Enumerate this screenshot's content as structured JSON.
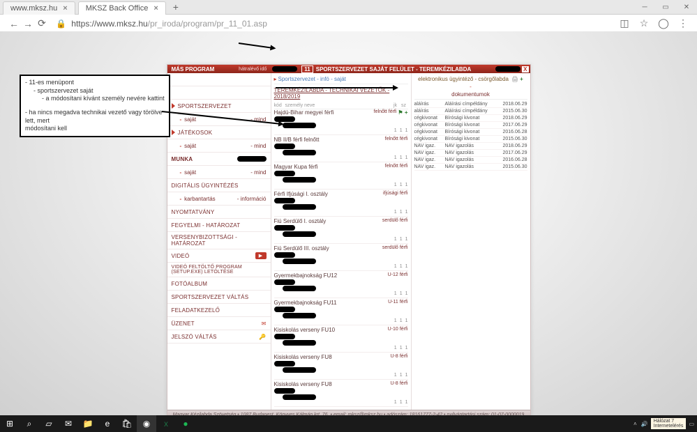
{
  "chrome": {
    "tab1": "www.mksz.hu",
    "tab2": "MKSZ Back Office",
    "url_host": "https://www.mksz.hu",
    "url_path": "/pr_iroda/program/pr_11_01.asp"
  },
  "header": {
    "left": "MÁS PROGRAM",
    "mid_small": "hátralévő idő",
    "badge": "11",
    "title": "SPORTSZERVEZET SAJÁT FELÜLET - TEREMKÉZILABDA"
  },
  "menu": {
    "items": [
      {
        "type": "red",
        "label": ""
      },
      {
        "type": "hdr",
        "label": ""
      },
      {
        "type": "tri",
        "label": "SPORTSZERVEZET"
      },
      {
        "type": "subpair",
        "left": "- saját",
        "right": "- mind"
      },
      {
        "type": "tri",
        "label": "JÁTÉKOSOK"
      },
      {
        "type": "subpair",
        "left": "- saját",
        "right": "- mind"
      },
      {
        "type": "redbold",
        "label": "MUNKA"
      },
      {
        "type": "subpair",
        "left": "- saját",
        "right": "- mind"
      },
      {
        "type": "red",
        "label": "DIGITÁLIS ÜGYINTÉZÉS"
      },
      {
        "type": "subpair",
        "left": "- karbantartás",
        "right": "- információ"
      },
      {
        "type": "red",
        "label": "NYOMTATVÁNY"
      },
      {
        "type": "red",
        "label": "FEGYELMI - HATÁROZAT"
      },
      {
        "type": "red",
        "label": "VERSENYBIZOTTSÁGI - HATÁROZAT"
      },
      {
        "type": "red",
        "label": "VIDEÓ",
        "icon": "vid"
      },
      {
        "type": "red",
        "label": "VIDEÓ feltöltő program (setup.exe) letöltése",
        "small": true
      },
      {
        "type": "red",
        "label": "FOTÓALBUM"
      },
      {
        "type": "red",
        "label": "SPORTSZERVEZET VÁLTÁS"
      },
      {
        "type": "red",
        "label": "FELADATKEZELŐ"
      },
      {
        "type": "red",
        "label": "ÜZENET",
        "icon": "mail"
      },
      {
        "type": "red",
        "label": "JELSZÓ VÁLTÁS",
        "icon": "key"
      }
    ]
  },
  "center": {
    "crumb": "Sportszervezet - infó - saját",
    "title": "TEREMKÉZILABDA - TECHNIKAI VEZETŐK - 2018/2019",
    "cols": {
      "c1": "kód",
      "c2": "személy neve",
      "c3": "jk",
      "c4": "sz"
    },
    "blocks": [
      {
        "name": "Hajdú-Bihar megyei férfi",
        "tag": "felnőtt",
        "gender": "férfi",
        "plus": true
      },
      {
        "name": "NB II/B férfi felnőtt",
        "tag": "felnőtt",
        "gender": "férfi"
      },
      {
        "name": "Magyar Kupa férfi",
        "tag": "felnőtt",
        "gender": "férfi"
      },
      {
        "name": "Férfi Ifjúsági I. osztály",
        "tag": "ifjúsági",
        "gender": "férfi"
      },
      {
        "name": "Fiú Serdülő I. osztály",
        "tag": "serdülő",
        "gender": "férfi"
      },
      {
        "name": "Fiú Serdülő III. osztály",
        "tag": "serdülő",
        "gender": "férfi"
      },
      {
        "name": "Gyermekbajnokság FU12",
        "tag": "U-12",
        "gender": "férfi"
      },
      {
        "name": "Gyermekbajnokság FU11",
        "tag": "U-11",
        "gender": "férfi"
      },
      {
        "name": "Kisiskolás verseny FU10",
        "tag": "U-10",
        "gender": "férfi"
      },
      {
        "name": "Kisiskolás verseny FU8",
        "tag": "U-8",
        "gender": "férfi"
      },
      {
        "name": "Kisiskolás verseny FU8",
        "tag": "U-8",
        "gender": "férfi"
      }
    ]
  },
  "rightp": {
    "hdr": "elektronikus ügyintéző - csörgőlabda",
    "sub": "dokumentumok",
    "rows": [
      {
        "a": "aláírás",
        "b": "Aláírási címpéldány",
        "c": "2018.06.29"
      },
      {
        "a": "aláírás",
        "b": "Aláírási címpéldány",
        "c": "2015.06.30"
      },
      {
        "a": "cégkivonat",
        "b": "Bírósági kivonat",
        "c": "2018.06.29"
      },
      {
        "a": "cégkivonat",
        "b": "Bírósági kivonat",
        "c": "2017.06.29"
      },
      {
        "a": "cégkivonat",
        "b": "Bírósági kivonat",
        "c": "2016.06.28"
      },
      {
        "a": "cégkivonat",
        "b": "Bírósági kivonat",
        "c": "2015.06.30"
      },
      {
        "a": "NAV igaz.",
        "b": "NAV igazolás",
        "c": "2018.06.29"
      },
      {
        "a": "NAV igaz.",
        "b": "NAV igazolás",
        "c": "2017.06.29"
      },
      {
        "a": "NAV igaz.",
        "b": "NAV igazolás",
        "c": "2016.06.28"
      },
      {
        "a": "NAV igaz.",
        "b": "NAV igazolás",
        "c": "2015.06.30"
      }
    ]
  },
  "footer": "Magyar Kézilabda Szövetség • 1087 Budapest, Könyves Kálmán krt. 76. • email: mksz@mksz.hu • adószám: 18161777-2-42 • nyilvántartási szám: 01-07-0000019",
  "annot": {
    "l1": "- 11-es menüpont",
    "l2": "    - sportszervezet saját",
    "l3": "        - a módosítani kívánt személy nevére kattint",
    "l4": "- ha nincs megadva technikai vezető vagy törölve lett, mert",
    "l5": "módosítani kell"
  },
  "tray": {
    "net1": "Hálózat 7",
    "net2": "Internetelérés"
  }
}
